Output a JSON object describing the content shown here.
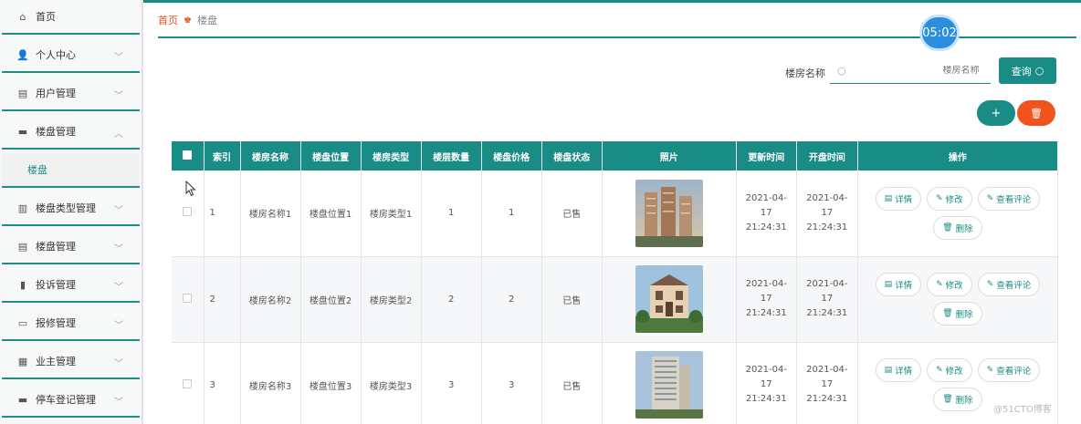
{
  "sidebar": {
    "items": [
      {
        "icon": "home-icon",
        "glyph": "⌂",
        "label": "首页",
        "chev": ""
      },
      {
        "icon": "user-icon",
        "glyph": "👤",
        "label": "个人中心",
        "chev": "﹀"
      },
      {
        "icon": "clipboard-icon",
        "glyph": "▤",
        "label": "用户管理",
        "chev": "﹀"
      },
      {
        "icon": "building-icon",
        "glyph": "▬",
        "label": "楼盘管理",
        "chev": "︿"
      }
    ],
    "sub_item": "楼盘",
    "items2": [
      {
        "icon": "bar-chart-icon",
        "glyph": "▥",
        "label": "楼盘类型管理",
        "chev": "﹀"
      },
      {
        "icon": "clipboard-icon",
        "glyph": "▤",
        "label": "楼盘管理",
        "chev": "﹀"
      },
      {
        "icon": "stats-icon",
        "glyph": "▮",
        "label": "投诉管理",
        "chev": "﹀"
      },
      {
        "icon": "chat-icon",
        "glyph": "▭",
        "label": "报修管理",
        "chev": "﹀"
      },
      {
        "icon": "grid-icon",
        "glyph": "▦",
        "label": "业主管理",
        "chev": "﹀"
      },
      {
        "icon": "car-icon",
        "glyph": "▬",
        "label": "停车登记管理",
        "chev": "﹀"
      }
    ]
  },
  "breadcrumb": {
    "home": "首页",
    "current": "楼盘"
  },
  "timer": "05:02",
  "search": {
    "label": "楼房名称",
    "placeholder": "楼房名称",
    "button": "查询"
  },
  "actions": {
    "add": "+",
    "delete": "🗑"
  },
  "table": {
    "headers": [
      "",
      "索引",
      "楼房名称",
      "楼盘位置",
      "楼房类型",
      "楼层数量",
      "楼盘价格",
      "楼盘状态",
      "照片",
      "更新时间",
      "开盘时间",
      "操作"
    ],
    "rows": [
      {
        "index": "1",
        "name": "楼房名称1",
        "location": "楼盘位置1",
        "type": "楼房类型1",
        "floors": "1",
        "price": "1",
        "status": "已售",
        "update_time": "2021-04-17 21:24:31",
        "open_time": "2021-04-17 21:24:31",
        "photo": "tower"
      },
      {
        "index": "2",
        "name": "楼房名称2",
        "location": "楼盘位置2",
        "type": "楼房类型2",
        "floors": "2",
        "price": "2",
        "status": "已售",
        "update_time": "2021-04-17 21:24:31",
        "open_time": "2021-04-17 21:24:31",
        "photo": "villa"
      },
      {
        "index": "3",
        "name": "楼房名称3",
        "location": "楼盘位置3",
        "type": "楼房类型3",
        "floors": "3",
        "price": "3",
        "status": "已售",
        "update_time": "2021-04-17 21:24:31",
        "open_time": "2021-04-17 21:24:31",
        "photo": "apartment"
      }
    ],
    "ops": {
      "detail": "详情",
      "edit": "修改",
      "comment": "查看评论",
      "delete": "删除"
    }
  },
  "watermark": "@51CTO博客",
  "colors": {
    "accent": "#1a8c86",
    "danger": "#f0541c",
    "timer": "#2d8ee0"
  }
}
